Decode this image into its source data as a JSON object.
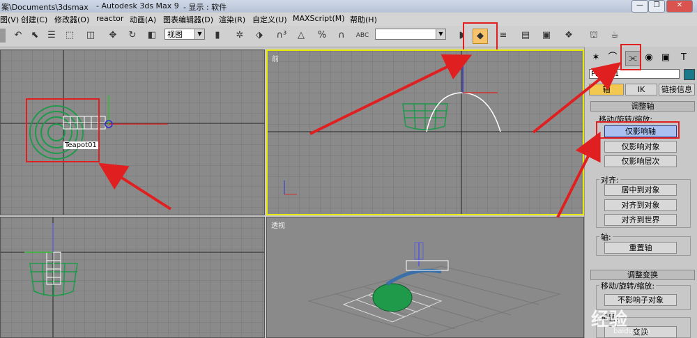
{
  "window": {
    "path_fragment": "案\\Documents\\3dsmax",
    "app_title": "- Autodesk 3ds Max 9",
    "display_mode": "- 显示 : 软件"
  },
  "menu": {
    "items": [
      "图(V)",
      "创建(C)",
      "修改器(O)",
      "reactor",
      "动画(A)",
      "图表编辑器(D)",
      "渲染(R)",
      "自定义(U)",
      "MAXScript(M)",
      "帮助(H)"
    ]
  },
  "toolbar": {
    "view_dropdown": "视图",
    "abc_label": "ABC"
  },
  "viewports": {
    "top_left": {
      "object_label": "Teapot01"
    },
    "top_right": {
      "label": "前"
    },
    "bottom_right": {
      "label": "透视"
    }
  },
  "command_panel": {
    "object_name": "Plane01",
    "tabs": {
      "pivot": "轴",
      "ik": "IK",
      "link_info": "链接信息"
    },
    "adjust_pivot": {
      "title": "调整轴",
      "move_rotate_scale": "移动/旋转/缩放:",
      "affect_pivot_only": "仅影响轴",
      "affect_object_only": "仅影响对象",
      "affect_hierarchy_only": "仅影响层次",
      "align_label": "对齐:",
      "center_to_object": "居中到对象",
      "align_to_object": "对齐到对象",
      "align_to_world": "对齐到世界",
      "pivot_label": "轴:",
      "reset_pivot": "重置轴"
    },
    "adjust_transform": {
      "title": "调整变换",
      "move_rotate_scale": "移动/旋转/缩放:",
      "dont_affect_children": "不影响子对象",
      "reset_label": "重置:",
      "transform": "变换"
    }
  },
  "watermark": {
    "text": "经验",
    "sub": "baidu.com"
  },
  "colors": {
    "highlight_red": "#e02020",
    "active_viewport": "#e8e800",
    "teapot": "#1f9a4a"
  }
}
